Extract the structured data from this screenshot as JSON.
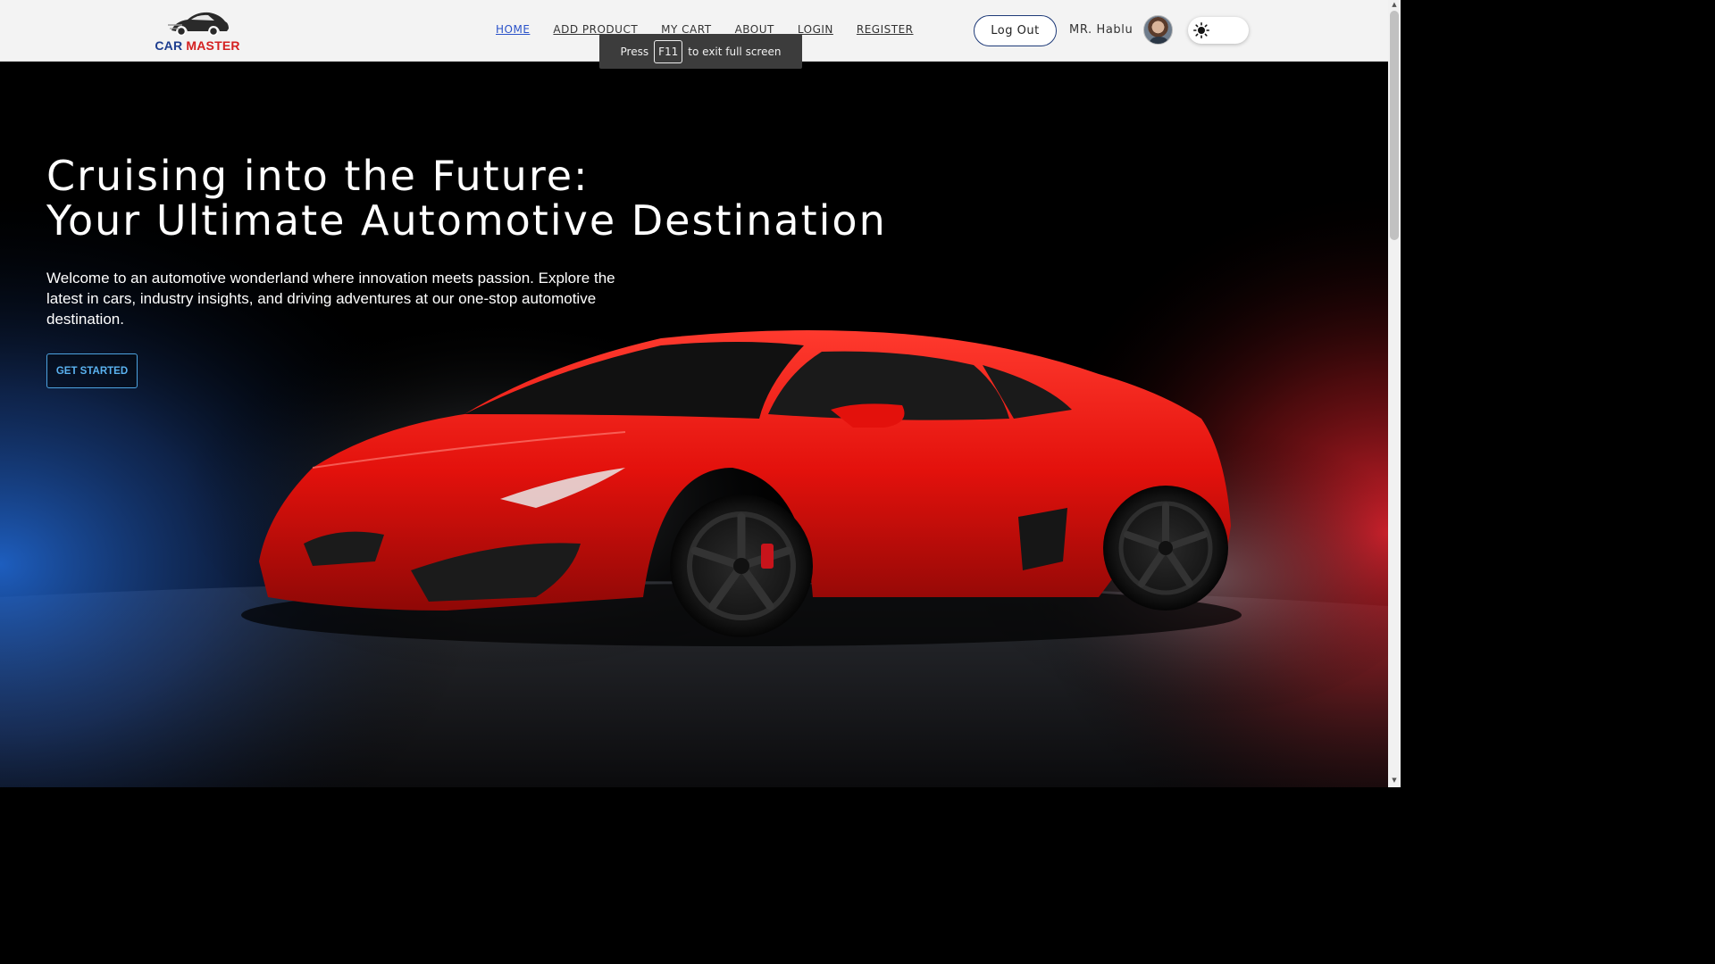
{
  "brand": {
    "word1": "CAR",
    "word2": "MASTER"
  },
  "nav": {
    "items": [
      {
        "label": "HOME",
        "active": true
      },
      {
        "label": "ADD PRODUCT",
        "active": false
      },
      {
        "label": "MY CART",
        "active": false
      },
      {
        "label": "ABOUT",
        "active": false
      },
      {
        "label": "LOGIN",
        "active": false
      },
      {
        "label": "REGISTER",
        "active": false
      }
    ]
  },
  "user": {
    "logout_label": "Log Out",
    "name": "MR. Hablu"
  },
  "toast": {
    "prefix": "Press",
    "key": "F11",
    "suffix": "to exit full screen"
  },
  "hero": {
    "title_line1": "Cruising into the Future:",
    "title_line2": "Your Ultimate Automotive Destination",
    "subtitle": "Welcome to an automotive wonderland where innovation meets passion. Explore the latest in cars, industry insights, and driving adventures at our one-stop automotive destination.",
    "cta_label": "GET STARTED"
  },
  "icons": {
    "logo": "car-logo-icon",
    "theme": "sun-icon",
    "avatar": "user-avatar"
  },
  "colors": {
    "accent_blue": "#2b53c9",
    "brand_red": "#d42020",
    "cta_blue": "#5ab2f0",
    "car_red": "#e0100e"
  }
}
